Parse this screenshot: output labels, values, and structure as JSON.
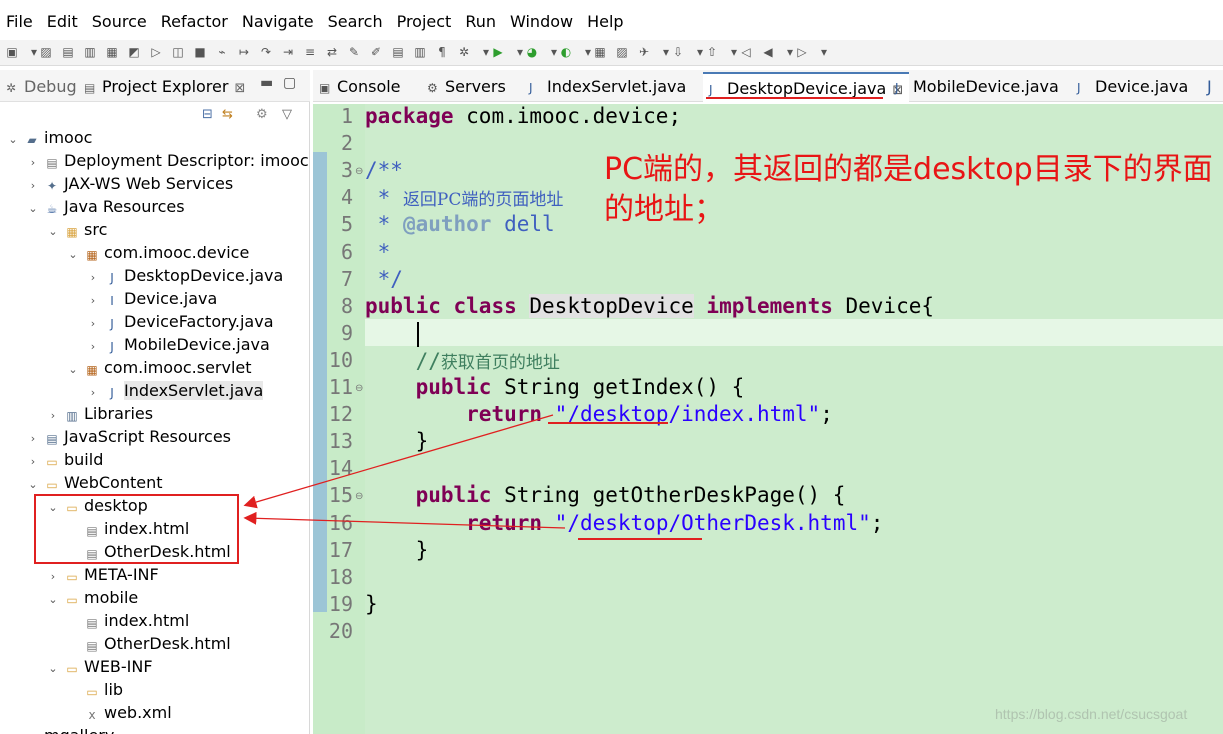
{
  "menubar": {
    "items": [
      "File",
      "Edit",
      "Source",
      "Refactor",
      "Navigate",
      "Search",
      "Project",
      "Run",
      "Window",
      "Help"
    ]
  },
  "left_panel": {
    "tabs": [
      {
        "label": "Debug",
        "icon": "debug-icon"
      },
      {
        "label": "Project Explorer",
        "icon": "project-explorer-icon",
        "close": "⊠"
      }
    ],
    "tree": [
      {
        "label": "imooc",
        "level": 0,
        "toggle": "⌄",
        "icon": "project-icon"
      },
      {
        "label": "Deployment Descriptor: imooc",
        "level": 1,
        "toggle": "›",
        "icon": "descriptor-icon"
      },
      {
        "label": "JAX-WS Web Services",
        "level": 1,
        "toggle": "›",
        "icon": "webservice-icon"
      },
      {
        "label": "Java Resources",
        "level": 1,
        "toggle": "⌄",
        "icon": "java-resources-icon"
      },
      {
        "label": "src",
        "level": 2,
        "toggle": "⌄",
        "icon": "source-folder-icon"
      },
      {
        "label": "com.imooc.device",
        "level": 3,
        "toggle": "⌄",
        "icon": "package-icon"
      },
      {
        "label": "DesktopDevice.java",
        "level": 4,
        "toggle": "›",
        "icon": "java-file-icon"
      },
      {
        "label": "Device.java",
        "level": 4,
        "toggle": "›",
        "icon": "java-interface-icon"
      },
      {
        "label": "DeviceFactory.java",
        "level": 4,
        "toggle": "›",
        "icon": "java-file-icon"
      },
      {
        "label": "MobileDevice.java",
        "level": 4,
        "toggle": "›",
        "icon": "java-file-icon"
      },
      {
        "label": "com.imooc.servlet",
        "level": 3,
        "toggle": "⌄",
        "icon": "package-icon"
      },
      {
        "label": "IndexServlet.java",
        "level": 4,
        "toggle": "›",
        "icon": "java-file-icon"
      },
      {
        "label": "Libraries",
        "level": 2,
        "toggle": "›",
        "icon": "libraries-icon"
      },
      {
        "label": "JavaScript Resources",
        "level": 1,
        "toggle": "›",
        "icon": "js-resources-icon"
      },
      {
        "label": "build",
        "level": 1,
        "toggle": "›",
        "icon": "folder-icon"
      },
      {
        "label": "WebContent",
        "level": 1,
        "toggle": "⌄",
        "icon": "folder-icon"
      },
      {
        "label": "desktop",
        "level": 2,
        "toggle": "⌄",
        "icon": "folder-icon"
      },
      {
        "label": "index.html",
        "level": 3,
        "toggle": "",
        "icon": "html-file-icon"
      },
      {
        "label": "OtherDesk.html",
        "level": 3,
        "toggle": "",
        "icon": "html-file-icon"
      },
      {
        "label": "META-INF",
        "level": 2,
        "toggle": "›",
        "icon": "folder-icon"
      },
      {
        "label": "mobile",
        "level": 2,
        "toggle": "⌄",
        "icon": "folder-icon"
      },
      {
        "label": "index.html",
        "level": 3,
        "toggle": "",
        "icon": "html-file-icon"
      },
      {
        "label": "OtherDesk.html",
        "level": 3,
        "toggle": "",
        "icon": "html-file-icon"
      },
      {
        "label": "WEB-INF",
        "level": 2,
        "toggle": "⌄",
        "icon": "folder-icon"
      },
      {
        "label": "lib",
        "level": 3,
        "toggle": "",
        "icon": "folder-icon"
      },
      {
        "label": "web.xml",
        "level": 3,
        "toggle": "",
        "icon": "xml-file-icon"
      },
      {
        "label": "mgallery",
        "level": 0,
        "toggle": "›",
        "icon": "project-icon"
      }
    ]
  },
  "editor": {
    "tabs": [
      {
        "label": "Console",
        "icon": "console-icon"
      },
      {
        "label": "Servers",
        "icon": "servers-icon"
      },
      {
        "label": "IndexServlet.java",
        "icon": "java-file-icon"
      },
      {
        "label": "DesktopDevice.java",
        "icon": "java-file-icon",
        "active": true,
        "close": "⊠"
      },
      {
        "label": "MobileDevice.java",
        "icon": "java-file-icon"
      },
      {
        "label": "Device.java",
        "icon": "java-file-icon"
      }
    ],
    "line_numbers": [
      "1",
      "2",
      "3",
      "4",
      "5",
      "6",
      "7",
      "8",
      "9",
      "10",
      "11",
      "12",
      "13",
      "14",
      "15",
      "16",
      "17",
      "18",
      "19",
      "20"
    ],
    "code": {
      "l1": [
        "package",
        " com.imooc.device;"
      ],
      "l3": "/**",
      "l4": [
        " * ",
        "返回PC端的页面地址"
      ],
      "l5": [
        " * ",
        "@author",
        " dell"
      ],
      "l6": " *",
      "l7": " */",
      "l8": [
        "public",
        " ",
        "class",
        " ",
        "DesktopDevice",
        " ",
        "implements",
        " Device{"
      ],
      "l10": [
        "    //",
        "获取首页的地址"
      ],
      "l11": [
        "    ",
        "public",
        " String getIndex() {"
      ],
      "l12": [
        "        ",
        "return",
        " ",
        "\"/desktop/index.html\"",
        ";"
      ],
      "l13": "    }",
      "l15": [
        "    ",
        "public",
        " String getOtherDeskPage() {"
      ],
      "l16": [
        "        ",
        "return",
        " ",
        "\"/desktop/OtherDesk.html\"",
        ";"
      ],
      "l17": "    }",
      "l19": "}"
    }
  },
  "annotation": {
    "text": "PC端的，其返回的都是desktop目录下的界面的地址；",
    "color": "#e81515"
  },
  "watermark": "https://blog.csdn.net/csucsgoat"
}
